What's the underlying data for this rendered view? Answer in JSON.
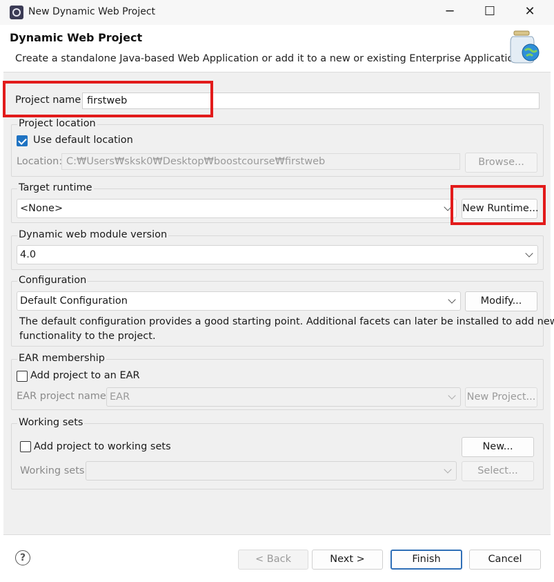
{
  "window": {
    "title": "New Dynamic Web Project",
    "minimize": "─",
    "maximize": "☐",
    "close": "✕"
  },
  "header": {
    "title": "Dynamic Web Project",
    "description": "Create a standalone Java-based Web Application or add it to a new or existing Enterprise Application."
  },
  "project_name": {
    "label": "Project name:",
    "value": "firstweb"
  },
  "project_location": {
    "group_label": "Project location",
    "use_default_label": "Use default location",
    "use_default_checked": true,
    "location_label": "Location:",
    "location_value": "C:₩Users₩sksk0₩Desktop₩boostcourse₩firstweb",
    "browse_label": "Browse..."
  },
  "target_runtime": {
    "group_label": "Target runtime",
    "selected": "<None>",
    "new_runtime_label": "New Runtime..."
  },
  "web_module": {
    "group_label": "Dynamic web module version",
    "selected": "4.0"
  },
  "configuration": {
    "group_label": "Configuration",
    "selected": "Default Configuration",
    "modify_label": "Modify...",
    "description_line1": "The default configuration provides a good starting point. Additional facets can later be installed to add new",
    "description_line2": "functionality to the project."
  },
  "ear": {
    "group_label": "EAR membership",
    "add_label": "Add project to an EAR",
    "add_checked": false,
    "name_label": "EAR project name:",
    "name_value": "EAR",
    "new_project_label": "New Project..."
  },
  "working_sets": {
    "group_label": "Working sets",
    "add_label": "Add project to working sets",
    "add_checked": false,
    "new_label": "New...",
    "sets_label": "Working sets:",
    "sets_value": "",
    "select_label": "Select..."
  },
  "footer": {
    "help": "?",
    "back_label": "< Back",
    "next_label": "Next >",
    "finish_label": "Finish",
    "cancel_label": "Cancel"
  },
  "colors": {
    "highlight": "#e21b1b",
    "accent": "#1f73c2",
    "dialog_bg": "#f0f0f0"
  }
}
